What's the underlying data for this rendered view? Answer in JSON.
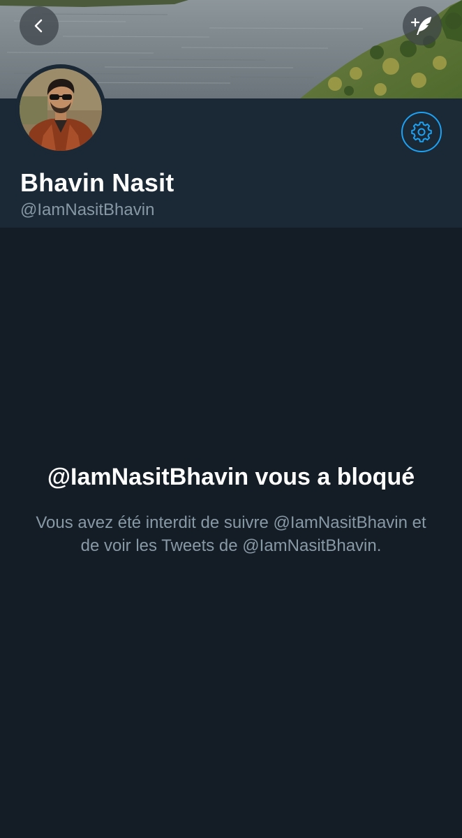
{
  "banner": {
    "description_icon": "landscape-banner"
  },
  "nav": {
    "back_icon": "chevron-left-icon",
    "compose_icon": "compose-tweet-icon"
  },
  "profile": {
    "display_name": "Bhavin Nasit",
    "handle": "@IamNasitBhavin",
    "avatar_icon": "avatar",
    "settings_icon": "gear-icon"
  },
  "blocked": {
    "title": "@IamNasitBhavin vous a bloqué",
    "description": "Vous avez été interdit de suivre @IamNasitBhavin et de voir les Tweets de @IamNasitBhavin."
  },
  "colors": {
    "background": "#141d26",
    "header_panel": "#1b2836",
    "accent": "#1da1f2",
    "secondary_text": "#8899a6"
  }
}
